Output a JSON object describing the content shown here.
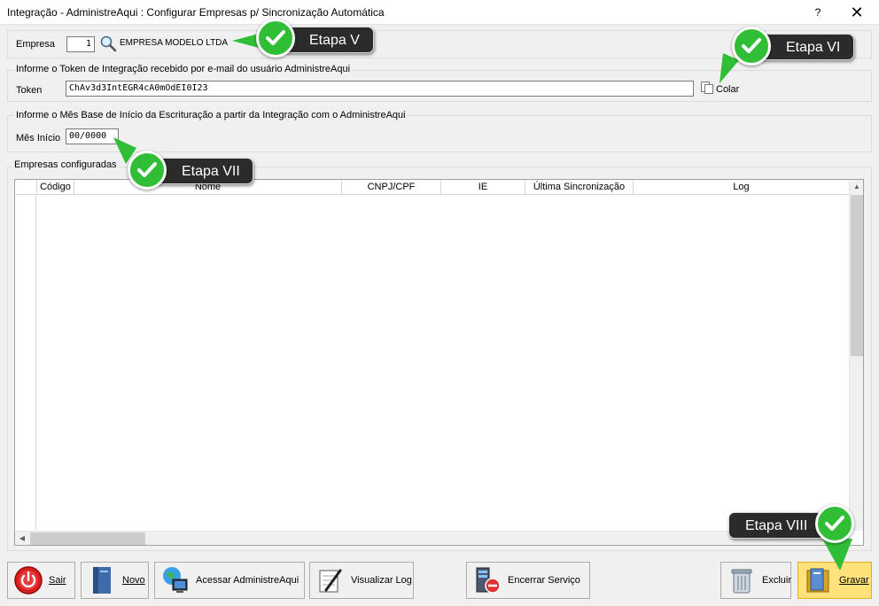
{
  "window": {
    "title": "Integração - AdministreAqui : Configurar Empresas p/ Sincronização Automática",
    "help_label": "?",
    "close_label": "✕"
  },
  "empresa": {
    "label": "Empresa",
    "code": "1",
    "name": "EMPRESA MODELO LTDA"
  },
  "token": {
    "group_title": "Informe o Token de Integração recebido por e-mail do usuário AdministreAqui",
    "label": "Token",
    "value": "ChAv3d3IntEGR4cA0mOdEI0I23",
    "paste_label": "Colar"
  },
  "mes": {
    "group_title": "Informe o Mês Base de Início da Escrituração a partir da Integração com o AdministreAqui",
    "label": "Mês Início",
    "value": "00/0000"
  },
  "grid": {
    "group_title": "Empresas configuradas",
    "columns": [
      "Código",
      "Nome",
      "CNPJ/CPF",
      "IE",
      "Última Sincronização",
      "Log"
    ]
  },
  "buttons": {
    "sair": "Sair",
    "novo": "Novo",
    "acessar": "Acessar AdministreAqui",
    "log": "Visualizar Log",
    "encerrar": "Encerrar Serviço",
    "excluir": "Excluir",
    "gravar": "Gravar"
  },
  "callouts": {
    "v": "Etapa V",
    "vi": "Etapa VI",
    "vii": "Etapa VII",
    "viii": "Etapa VIII"
  },
  "colors": {
    "callout_bg": "#2b2b2b",
    "check_green": "#2fbe35",
    "gravar_bg": "#ffe27a"
  }
}
